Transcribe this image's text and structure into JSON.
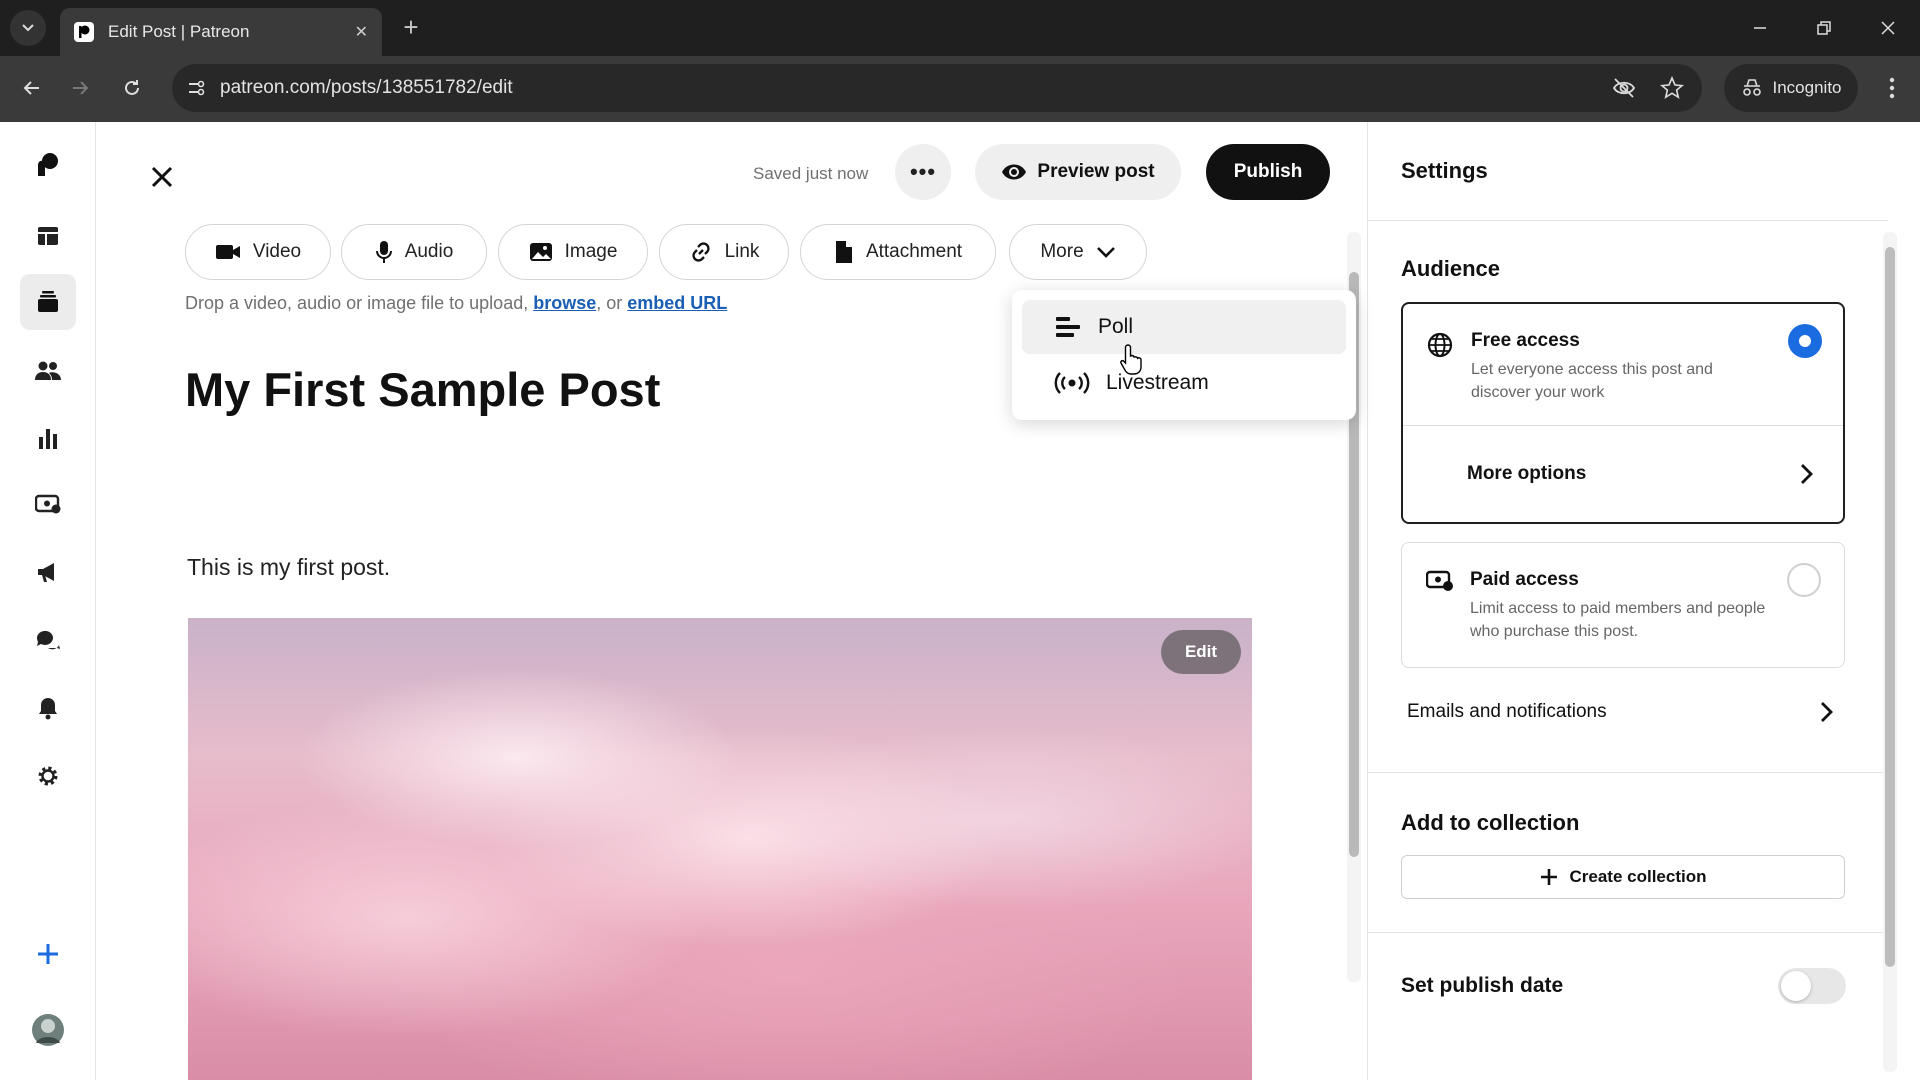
{
  "browser": {
    "tab_title": "Edit Post | Patreon",
    "url": "patreon.com/posts/138551782/edit",
    "incognito_label": "Incognito",
    "new_tab_symbol": "+",
    "close_tab_symbol": "✕"
  },
  "editor": {
    "saved_status": "Saved just now",
    "more_actions_symbol": "•••",
    "preview_label": "Preview post",
    "publish_label": "Publish",
    "media_buttons": [
      {
        "label": "Video",
        "icon": "video-camera-icon"
      },
      {
        "label": "Audio",
        "icon": "microphone-icon"
      },
      {
        "label": "Image",
        "icon": "image-icon"
      },
      {
        "label": "Link",
        "icon": "link-icon"
      },
      {
        "label": "Attachment",
        "icon": "file-icon"
      },
      {
        "label": "More",
        "icon": "chevron-down-icon"
      }
    ],
    "drop_hint_prefix": "Drop a video, audio or image file to upload, ",
    "drop_hint_browse": "browse",
    "drop_hint_middle": ", or ",
    "drop_hint_embed": "embed URL",
    "post_title": "My First Sample Post",
    "post_body": "This is my first post.",
    "image_edit_label": "Edit"
  },
  "more_menu": {
    "items": [
      {
        "label": "Poll",
        "icon": "poll-icon"
      },
      {
        "label": "Livestream",
        "icon": "livestream-icon"
      }
    ]
  },
  "settings": {
    "title": "Settings",
    "audience_title": "Audience",
    "free_access": {
      "title": "Free access",
      "description": "Let everyone access this post and discover your work",
      "selected": true
    },
    "more_options_label": "More options",
    "paid_access": {
      "title": "Paid access",
      "description": "Limit access to paid members and people who purchase this post.",
      "selected": false
    },
    "emails_label": "Emails and notifications",
    "collection_title": "Add to collection",
    "create_collection_label": "Create collection",
    "publish_date_label": "Set publish date",
    "publish_date_enabled": false
  },
  "colors": {
    "accent_blue": "#1a6ce0",
    "publish_bg": "#111111",
    "link_blue": "#1a5fb4"
  }
}
